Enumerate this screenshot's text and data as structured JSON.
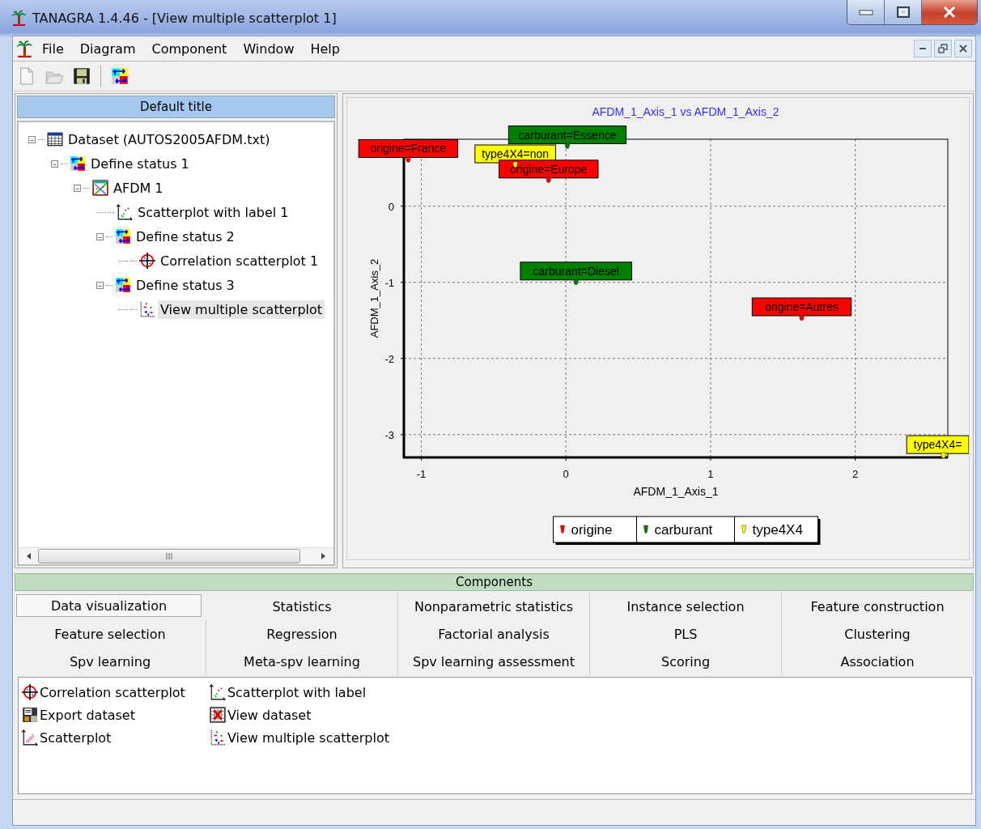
{
  "window": {
    "title": "TANAGRA 1.4.46 - [View multiple scatterplot 1]"
  },
  "menu": [
    "File",
    "Diagram",
    "Component",
    "Window",
    "Help"
  ],
  "toolbar": [
    {
      "kind": "new",
      "disabled": true
    },
    {
      "kind": "open",
      "disabled": true
    },
    {
      "kind": "save",
      "disabled": false
    },
    {
      "kind": "status",
      "disabled": false
    }
  ],
  "diagram": {
    "title": "Default title",
    "tree": [
      {
        "label": "Dataset (AUTOS2005AFDM.txt)",
        "kind": "dataset",
        "expanded": true,
        "selected": false,
        "children": [
          {
            "label": "Define status 1",
            "kind": "status",
            "expanded": true,
            "selected": false,
            "children": [
              {
                "label": "AFDM 1",
                "kind": "afdm",
                "expanded": true,
                "selected": false,
                "children": [
                  {
                    "label": "Scatterplot with label 1",
                    "kind": "scatter-label",
                    "selected": false
                  },
                  {
                    "label": "Define status 2",
                    "kind": "status",
                    "expanded": true,
                    "selected": false,
                    "children": [
                      {
                        "label": "Correlation scatterplot 1",
                        "kind": "correlation",
                        "selected": false
                      }
                    ]
                  },
                  {
                    "label": "Define status 3",
                    "kind": "status",
                    "expanded": true,
                    "selected": false,
                    "children": [
                      {
                        "label": "View multiple scatterplot",
                        "kind": "multi-scatter",
                        "selected": true
                      }
                    ]
                  }
                ]
              }
            ]
          }
        ]
      }
    ]
  },
  "view": {
    "chart_data": {
      "type": "scatter",
      "title": "AFDM_1_Axis_1 vs AFDM_1_Axis_2",
      "xlabel": "AFDM_1_Axis_1",
      "ylabel": "AFDM_1_Axis_2",
      "series": [
        {
          "name": "origine",
          "color": "#ff0000",
          "x": [
            -1.09,
            -0.12,
            1.63
          ],
          "values": [
            0.62,
            0.35,
            -1.46
          ]
        },
        {
          "name": "carburant",
          "color": "#008000",
          "x": [
            0.01,
            0.07
          ],
          "values": [
            0.8,
            -0.99
          ]
        },
        {
          "name": "type4X4",
          "color": "#ffff00",
          "x": [
            -0.35,
            2.61
          ],
          "values": [
            0.55,
            -3.27
          ]
        }
      ],
      "grid": true,
      "legend": "bottom",
      "xlim": [
        -1.12,
        2.64
      ],
      "ylim": [
        -3.3,
        0.88
      ],
      "xticks": [
        -1,
        0,
        1,
        2
      ],
      "yticks": [
        -3,
        -2,
        -1,
        0
      ],
      "annotations": [
        {
          "x": -0.35,
          "y": 0.55,
          "text": "type4X4=non"
        },
        {
          "x": -1.09,
          "y": 0.62,
          "text": "origine=France"
        },
        {
          "x": -0.12,
          "y": 0.35,
          "text": "origine=Europe"
        },
        {
          "x": 0.01,
          "y": 0.8,
          "text": "carburant=Essence"
        },
        {
          "x": 0.07,
          "y": -0.99,
          "text": "carburant=Diesel"
        },
        {
          "x": 1.63,
          "y": -1.46,
          "text": "origine=Autres"
        },
        {
          "x": 2.61,
          "y": -3.27,
          "text": "type4X4="
        }
      ]
    }
  },
  "components": {
    "title": "Components",
    "tabs": [
      {
        "label": "Data visualization",
        "selected": true
      },
      {
        "label": "Statistics",
        "selected": false
      },
      {
        "label": "Nonparametric statistics",
        "selected": false
      },
      {
        "label": "Instance selection",
        "selected": false
      },
      {
        "label": "Feature construction",
        "selected": false
      },
      {
        "label": "Feature selection",
        "selected": false
      },
      {
        "label": "Regression",
        "selected": false
      },
      {
        "label": "Factorial analysis",
        "selected": false
      },
      {
        "label": "PLS",
        "selected": false
      },
      {
        "label": "Clustering",
        "selected": false
      },
      {
        "label": "Spv learning",
        "selected": false
      },
      {
        "label": "Meta-spv learning",
        "selected": false
      },
      {
        "label": "Spv learning assessment",
        "selected": false
      },
      {
        "label": "Scoring",
        "selected": false
      },
      {
        "label": "Association",
        "selected": false
      }
    ],
    "items": [
      {
        "label": "Correlation scatterplot",
        "kind": "correlation"
      },
      {
        "label": "Export dataset",
        "kind": "export"
      },
      {
        "label": "Scatterplot",
        "kind": "scatterplot"
      },
      {
        "label": "Scatterplot with label",
        "kind": "scatter-label"
      },
      {
        "label": "View dataset",
        "kind": "view-dataset"
      },
      {
        "label": "View multiple scatterplot",
        "kind": "multi-scatter"
      }
    ]
  }
}
